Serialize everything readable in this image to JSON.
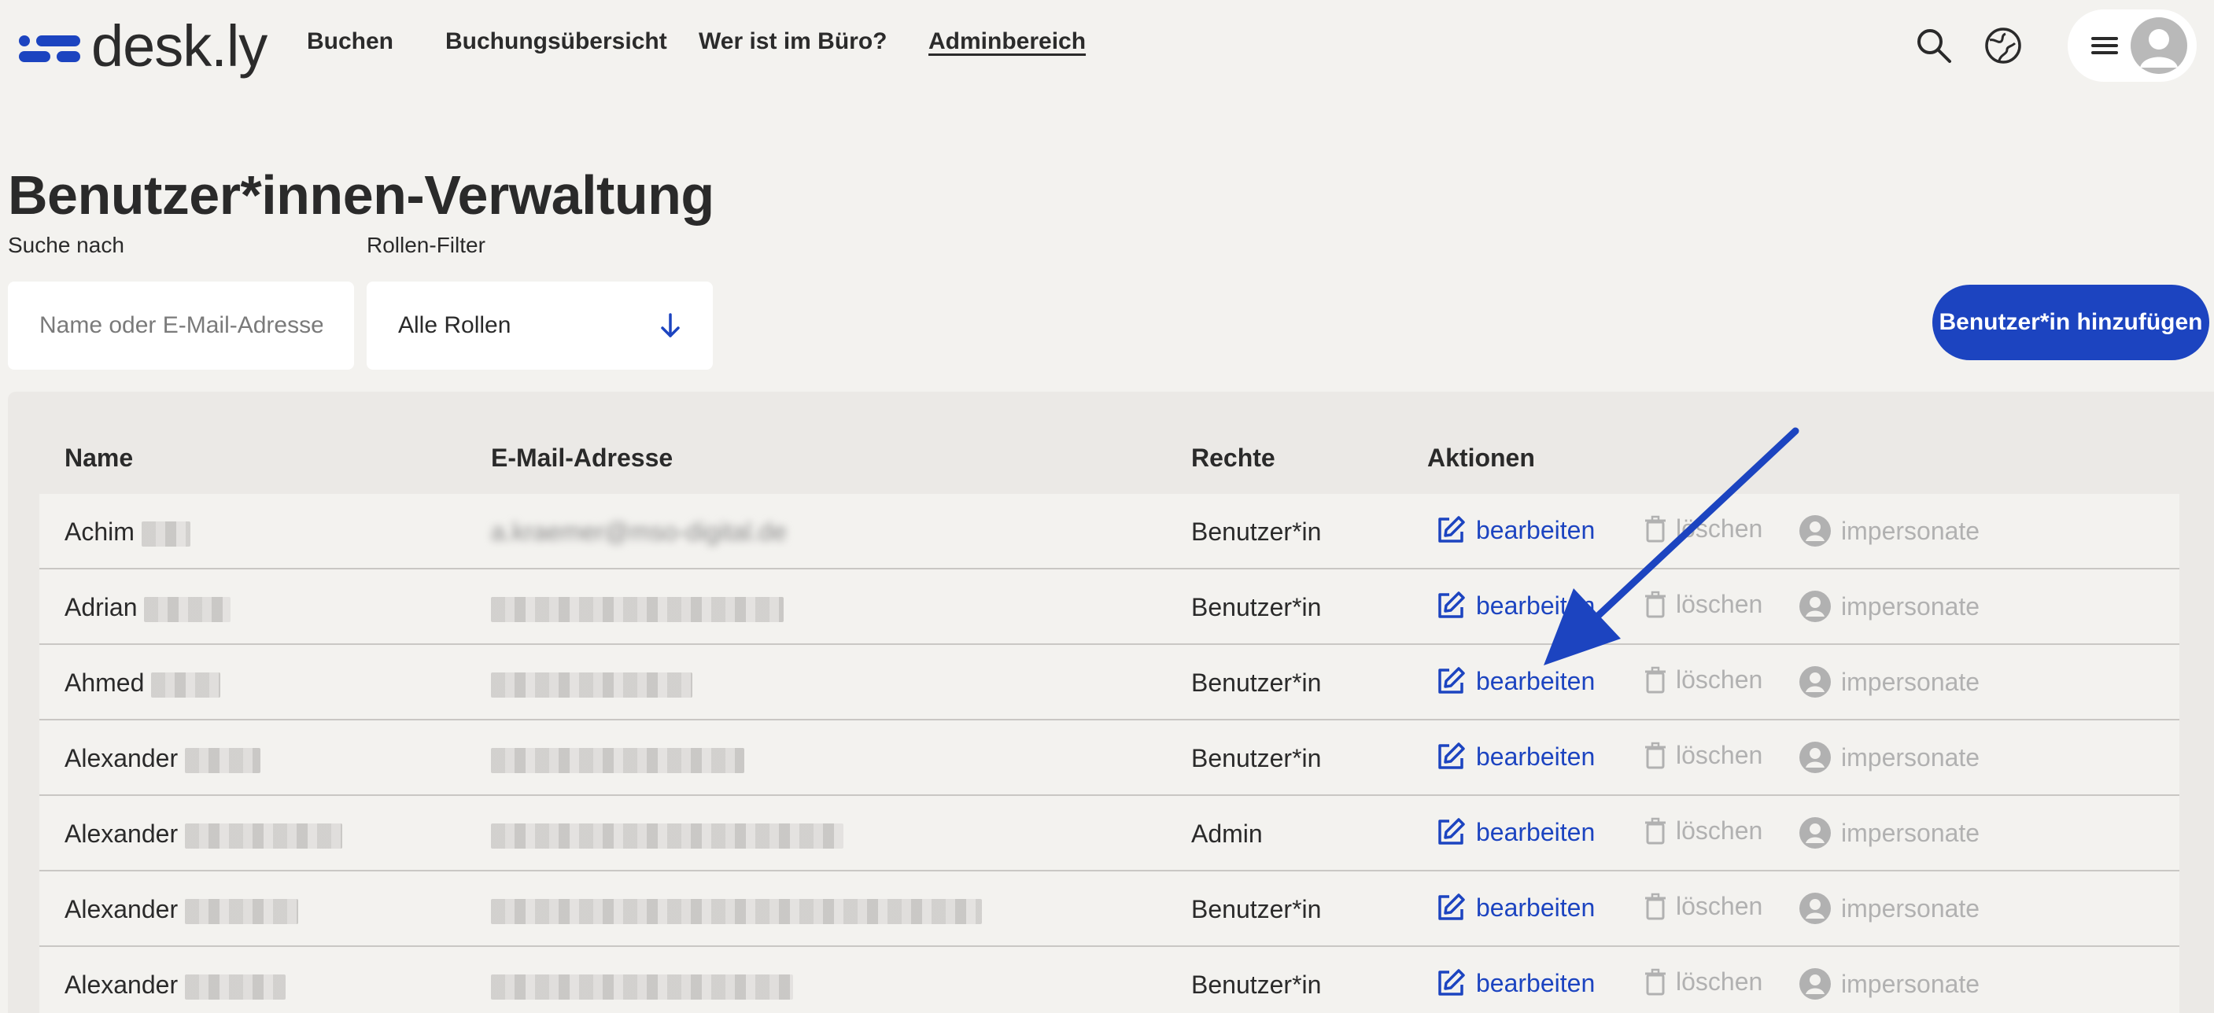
{
  "header": {
    "logo_text": "desk.ly",
    "nav": [
      {
        "label": "Buchen"
      },
      {
        "label": "Buchungsübersicht"
      },
      {
        "label": "Wer ist im Büro?"
      },
      {
        "label": "Adminbereich",
        "active": true
      }
    ],
    "icons": [
      "search-icon",
      "globe-icon",
      "hamburger-menu-icon",
      "user-avatar-icon"
    ]
  },
  "page": {
    "title": "Benutzer*innen-Verwaltung",
    "search_label": "Suche nach",
    "search_placeholder": "Name oder E-Mail-Adresse",
    "role_filter_label": "Rollen-Filter",
    "role_filter_value": "Alle Rollen",
    "add_button": "Benutzer*in hinzufügen"
  },
  "table": {
    "headers": [
      "Name",
      "E-Mail-Adresse",
      "Rechte",
      "Aktionen"
    ],
    "action_labels": {
      "edit": "bearbeiten",
      "delete": "löschen",
      "impersonate": "impersonate"
    },
    "rows": [
      {
        "first_name": "Achim",
        "email": "a.kraemer@mso-digital.de",
        "role": "Benutzer*in"
      },
      {
        "first_name": "Adrian",
        "role": "Benutzer*in"
      },
      {
        "first_name": "Ahmed",
        "role": "Benutzer*in"
      },
      {
        "first_name": "Alexander",
        "role": "Benutzer*in"
      },
      {
        "first_name": "Alexander",
        "role": "Admin"
      },
      {
        "first_name": "Alexander",
        "role": "Benutzer*in"
      },
      {
        "first_name": "Alexander",
        "role": "Benutzer*in"
      }
    ]
  },
  "colors": {
    "accent": "#1c44c0",
    "background": "#f3f2ef",
    "table_background": "#ebe9e6",
    "muted": "#b1b1b1"
  }
}
